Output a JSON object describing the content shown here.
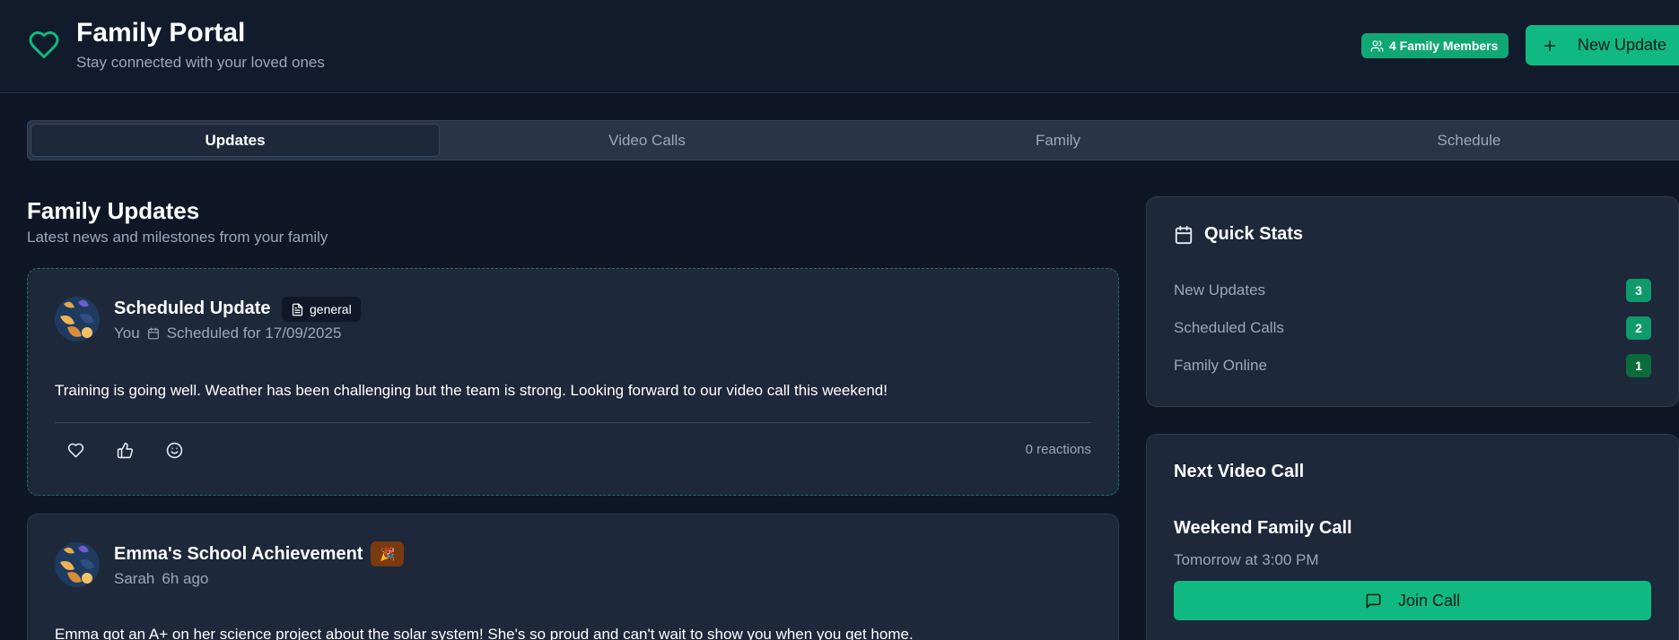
{
  "header": {
    "title": "Family Portal",
    "subtitle": "Stay connected with your loved ones",
    "members_badge": "4 Family Members",
    "new_update_label": "New Update"
  },
  "tabs": [
    {
      "label": "Updates",
      "active": true
    },
    {
      "label": "Video Calls",
      "active": false
    },
    {
      "label": "Family",
      "active": false
    },
    {
      "label": "Schedule",
      "active": false
    }
  ],
  "feed": {
    "title": "Family Updates",
    "subtitle": "Latest news and milestones from your family",
    "posts": [
      {
        "title": "Scheduled Update",
        "tag": "general",
        "tag_icon": "document-icon",
        "author": "You",
        "time": "Scheduled for 17/09/2025",
        "body": "Training is going well. Weather has been challenging but the team is strong. Looking forward to our video call this weekend!",
        "reactions": "0 reactions"
      },
      {
        "title": "Emma's School Achievement",
        "tag": "🎉",
        "author": "Sarah",
        "time": "6h ago",
        "body": "Emma got an A+ on her science project about the solar system! She's so proud and can't wait to show you when you get home."
      }
    ]
  },
  "sidebar": {
    "quick_stats": {
      "title": "Quick Stats",
      "items": [
        {
          "label": "New Updates",
          "value": "3"
        },
        {
          "label": "Scheduled Calls",
          "value": "2"
        },
        {
          "label": "Family Online",
          "value": "1"
        }
      ]
    },
    "next_call": {
      "title": "Next Video Call",
      "call_name": "Weekend Family Call",
      "call_time": "Tomorrow at 3:00 PM",
      "join_label": "Join Call"
    }
  },
  "colors": {
    "accent": "#10b981",
    "background": "#0f1727",
    "card": "#1d283a",
    "muted_text": "#9aa8bb"
  }
}
